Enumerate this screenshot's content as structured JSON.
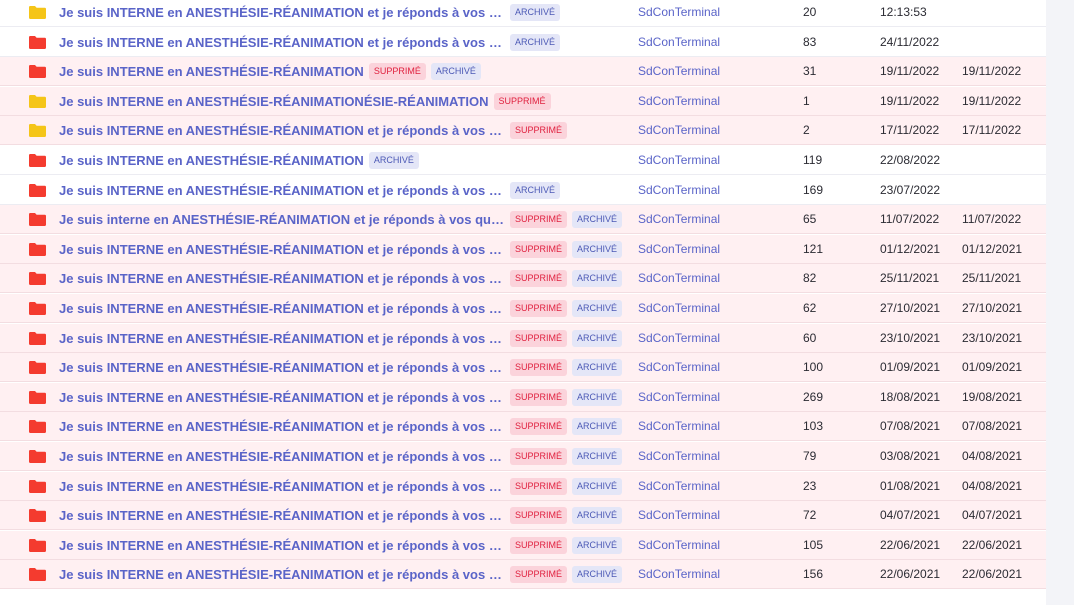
{
  "colors": {
    "folder_red": "#f43b2f",
    "folder_yellow": "#f5c518",
    "link": "#5a64c8",
    "deleted_row_bg": "#fff0f2"
  },
  "badges": {
    "deleted": "SUPPRIMÉ",
    "archived": "ARCHIVÉ"
  },
  "rows": [
    {
      "folder": "yellow",
      "title": "Je suis INTERNE en ANESTHÉSIE-RÉANIMATION et je réponds à vos questions",
      "deleted": false,
      "archived": true,
      "author": "SdConTerminal",
      "count": "20",
      "date1": "12:13:53",
      "date2": ""
    },
    {
      "folder": "red",
      "title": "Je suis INTERNE en ANESTHÉSIE-RÉANIMATION et je réponds à vos questions",
      "deleted": false,
      "archived": true,
      "author": "SdConTerminal",
      "count": "83",
      "date1": "24/11/2022",
      "date2": ""
    },
    {
      "folder": "red",
      "title": "Je suis INTERNE en ANESTHÉSIE-RÉANIMATION",
      "deleted": true,
      "archived": true,
      "author": "SdConTerminal",
      "count": "31",
      "date1": "19/11/2022",
      "date2": "19/11/2022"
    },
    {
      "folder": "yellow",
      "title": "Je suis INTERNE en ANESTHÉSIE-RÉANIMATIONÉSIE-RÉANIMATION",
      "deleted": true,
      "archived": false,
      "author": "SdConTerminal",
      "count": "1",
      "date1": "19/11/2022",
      "date2": "19/11/2022"
    },
    {
      "folder": "yellow",
      "title": "Je suis INTERNE en ANESTHÉSIE-RÉANIMATION et je réponds à vos questions",
      "deleted": true,
      "archived": false,
      "author": "SdConTerminal",
      "count": "2",
      "date1": "17/11/2022",
      "date2": "17/11/2022"
    },
    {
      "folder": "red",
      "title": "Je suis INTERNE en ANESTHÉSIE-RÉANIMATION",
      "deleted": false,
      "archived": true,
      "author": "SdConTerminal",
      "count": "119",
      "date1": "22/08/2022",
      "date2": ""
    },
    {
      "folder": "red",
      "title": "Je suis INTERNE en ANESTHÉSIE-RÉANIMATION et je réponds à vos questions",
      "deleted": false,
      "archived": true,
      "author": "SdConTerminal",
      "count": "169",
      "date1": "23/07/2022",
      "date2": ""
    },
    {
      "folder": "red",
      "title": "Je suis interne en ANESTHÉSIE-RÉANIMATION et je réponds à vos questions",
      "deleted": true,
      "archived": true,
      "author": "SdConTerminal",
      "count": "65",
      "date1": "11/07/2022",
      "date2": "11/07/2022"
    },
    {
      "folder": "red",
      "title": "Je suis INTERNE en ANESTHÉSIE-RÉANIMATION et je réponds à vos questio...",
      "deleted": true,
      "archived": true,
      "author": "SdConTerminal",
      "count": "121",
      "date1": "01/12/2021",
      "date2": "01/12/2021"
    },
    {
      "folder": "red",
      "title": "Je suis INTERNE en ANESTHÉSIE-RÉANIMATION et je réponds à vos questio...",
      "deleted": true,
      "archived": true,
      "author": "SdConTerminal",
      "count": "82",
      "date1": "25/11/2021",
      "date2": "25/11/2021"
    },
    {
      "folder": "red",
      "title": "Je suis INTERNE en ANESTHÉSIE-RÉANIMATION et je réponds à vos questio...",
      "deleted": true,
      "archived": true,
      "author": "SdConTerminal",
      "count": "62",
      "date1": "27/10/2021",
      "date2": "27/10/2021"
    },
    {
      "folder": "red",
      "title": "Je suis INTERNE en ANESTHÉSIE-RÉANIMATION et je réponds à vos questio...",
      "deleted": true,
      "archived": true,
      "author": "SdConTerminal",
      "count": "60",
      "date1": "23/10/2021",
      "date2": "23/10/2021"
    },
    {
      "folder": "red",
      "title": "Je suis INTERNE en ANESTHÉSIE-RÉANIMATION et je réponds à vos questio...",
      "deleted": true,
      "archived": true,
      "author": "SdConTerminal",
      "count": "100",
      "date1": "01/09/2021",
      "date2": "01/09/2021"
    },
    {
      "folder": "red",
      "title": "Je suis INTERNE en ANESTHÉSIE-RÉANIMATION et je réponds à vos questio...",
      "deleted": true,
      "archived": true,
      "author": "SdConTerminal",
      "count": "269",
      "date1": "18/08/2021",
      "date2": "19/08/2021"
    },
    {
      "folder": "red",
      "title": "Je suis INTERNE en ANESTHÉSIE-RÉANIMATION et je réponds à vos questio...",
      "deleted": true,
      "archived": true,
      "author": "SdConTerminal",
      "count": "103",
      "date1": "07/08/2021",
      "date2": "07/08/2021"
    },
    {
      "folder": "red",
      "title": "Je suis INTERNE en ANESTHÉSIE-RÉANIMATION et je réponds à vos questio...",
      "deleted": true,
      "archived": true,
      "author": "SdConTerminal",
      "count": "79",
      "date1": "03/08/2021",
      "date2": "04/08/2021"
    },
    {
      "folder": "red",
      "title": "Je suis INTERNE en ANESTHÉSIE-RÉANIMATION et je réponds à vos questio...",
      "deleted": true,
      "archived": true,
      "author": "SdConTerminal",
      "count": "23",
      "date1": "01/08/2021",
      "date2": "04/08/2021"
    },
    {
      "folder": "red",
      "title": "Je suis INTERNE en ANESTHÉSIE-RÉANIMATION et je réponds à vos questio...",
      "deleted": true,
      "archived": true,
      "author": "SdConTerminal",
      "count": "72",
      "date1": "04/07/2021",
      "date2": "04/07/2021"
    },
    {
      "folder": "red",
      "title": "Je suis INTERNE en ANESTHÉSIE-RÉANIMATION et je réponds à vos questio...",
      "deleted": true,
      "archived": true,
      "author": "SdConTerminal",
      "count": "105",
      "date1": "22/06/2021",
      "date2": "22/06/2021"
    },
    {
      "folder": "red",
      "title": "Je suis INTERNE en ANESTHÉSIE-RÉANIMATION et je réponds à vos questio...",
      "deleted": true,
      "archived": true,
      "author": "SdConTerminal",
      "count": "156",
      "date1": "22/06/2021",
      "date2": "22/06/2021"
    }
  ]
}
